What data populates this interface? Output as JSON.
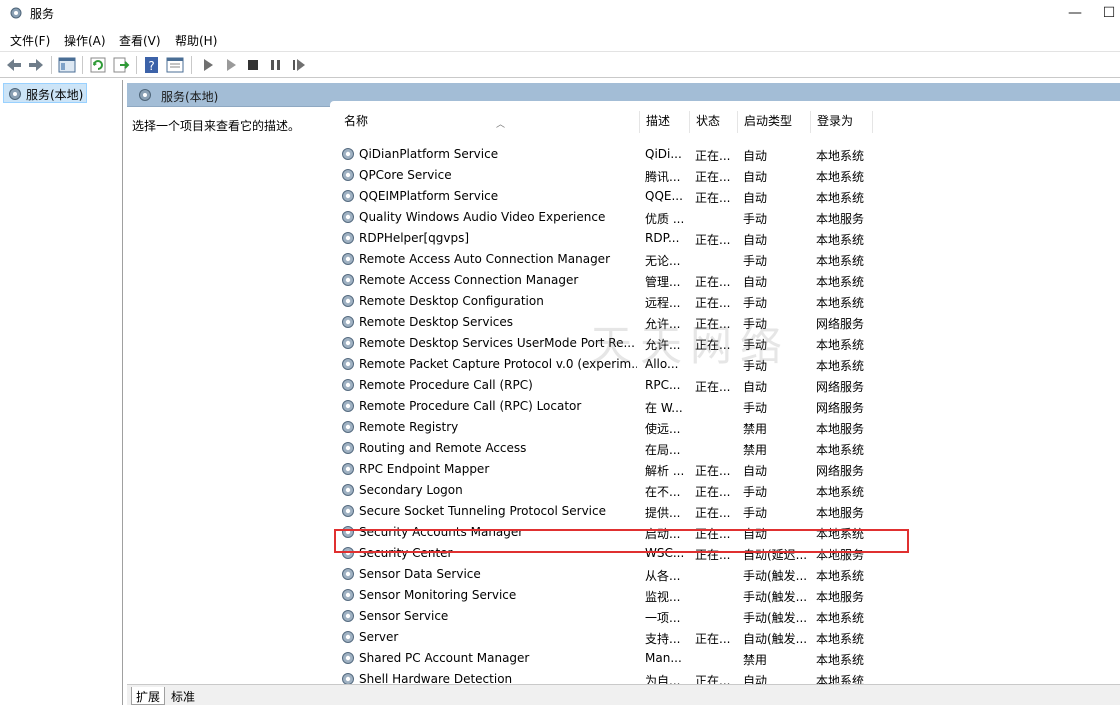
{
  "window": {
    "title": "服务",
    "min": "—",
    "max": "☐"
  },
  "menu": [
    "文件(F)",
    "操作(A)",
    "查看(V)",
    "帮助(H)"
  ],
  "toolbar_icons": [
    "back-arrow-icon",
    "forward-arrow-icon",
    "show-hide-console-tree-icon",
    "refresh-icon",
    "export-list-icon",
    "help-icon",
    "properties-icon",
    "start-service-icon",
    "start-service-alt-icon",
    "stop-service-icon",
    "pause-service-icon",
    "resume-service-icon"
  ],
  "tree": {
    "root": "服务(本地)"
  },
  "main": {
    "header_title": "服务(本地)",
    "description": "选择一个项目来查看它的描述。",
    "columns": [
      "名称",
      "描述",
      "状态",
      "启动类型",
      "登录为"
    ],
    "rows": [
      {
        "name": "QiDianPlatform Service",
        "desc": "QiDi...",
        "status": "正在...",
        "start": "自动",
        "logon": "本地系统"
      },
      {
        "name": "QPCore Service",
        "desc": "腾讯...",
        "status": "正在...",
        "start": "自动",
        "logon": "本地系统"
      },
      {
        "name": "QQEIMPlatform Service",
        "desc": "QQE...",
        "status": "正在...",
        "start": "自动",
        "logon": "本地系统"
      },
      {
        "name": "Quality Windows Audio Video Experience",
        "desc": "优质 ...",
        "status": "",
        "start": "手动",
        "logon": "本地服务"
      },
      {
        "name": "RDPHelper[qgvps]",
        "desc": "RDP...",
        "status": "正在...",
        "start": "自动",
        "logon": "本地系统"
      },
      {
        "name": "Remote Access Auto Connection Manager",
        "desc": "无论...",
        "status": "",
        "start": "手动",
        "logon": "本地系统"
      },
      {
        "name": "Remote Access Connection Manager",
        "desc": "管理...",
        "status": "正在...",
        "start": "自动",
        "logon": "本地系统"
      },
      {
        "name": "Remote Desktop Configuration",
        "desc": "远程...",
        "status": "正在...",
        "start": "手动",
        "logon": "本地系统"
      },
      {
        "name": "Remote Desktop Services",
        "desc": "允许...",
        "status": "正在...",
        "start": "手动",
        "logon": "网络服务"
      },
      {
        "name": "Remote Desktop Services UserMode Port Re...",
        "desc": "允许...",
        "status": "正在...",
        "start": "手动",
        "logon": "本地系统"
      },
      {
        "name": "Remote Packet Capture Protocol v.0 (experim...",
        "desc": "Allo...",
        "status": "",
        "start": "手动",
        "logon": "本地系统"
      },
      {
        "name": "Remote Procedure Call (RPC)",
        "desc": "RPC...",
        "status": "正在...",
        "start": "自动",
        "logon": "网络服务"
      },
      {
        "name": "Remote Procedure Call (RPC) Locator",
        "desc": "在 W...",
        "status": "",
        "start": "手动",
        "logon": "网络服务"
      },
      {
        "name": "Remote Registry",
        "desc": "使远...",
        "status": "",
        "start": "禁用",
        "logon": "本地服务"
      },
      {
        "name": "Routing and Remote Access",
        "desc": "在局...",
        "status": "",
        "start": "禁用",
        "logon": "本地系统"
      },
      {
        "name": "RPC Endpoint Mapper",
        "desc": "解析 ...",
        "status": "正在...",
        "start": "自动",
        "logon": "网络服务"
      },
      {
        "name": "Secondary Logon",
        "desc": "在不...",
        "status": "正在...",
        "start": "手动",
        "logon": "本地系统"
      },
      {
        "name": "Secure Socket Tunneling Protocol Service",
        "desc": "提供...",
        "status": "正在...",
        "start": "手动",
        "logon": "本地服务"
      },
      {
        "name": "Security Accounts Manager",
        "desc": "启动...",
        "status": "正在...",
        "start": "自动",
        "logon": "本地系统"
      },
      {
        "name": "Security Center",
        "desc": "WSC...",
        "status": "正在...",
        "start": "自动(延迟...",
        "logon": "本地服务"
      },
      {
        "name": "Sensor Data Service",
        "desc": "从各...",
        "status": "",
        "start": "手动(触发...",
        "logon": "本地系统"
      },
      {
        "name": "Sensor Monitoring Service",
        "desc": "监视...",
        "status": "",
        "start": "手动(触发...",
        "logon": "本地服务"
      },
      {
        "name": "Sensor Service",
        "desc": "一项...",
        "status": "",
        "start": "手动(触发...",
        "logon": "本地系统"
      },
      {
        "name": "Server",
        "desc": "支持...",
        "status": "正在...",
        "start": "自动(触发...",
        "logon": "本地系统"
      },
      {
        "name": "Shared PC Account Manager",
        "desc": "Man...",
        "status": "",
        "start": "禁用",
        "logon": "本地系统"
      },
      {
        "name": "Shell Hardware Detection",
        "desc": "为自...",
        "status": "正在...",
        "start": "自动",
        "logon": "本地系统"
      }
    ]
  },
  "watermark": "天天网络",
  "tabs": [
    "扩展",
    "标准"
  ]
}
